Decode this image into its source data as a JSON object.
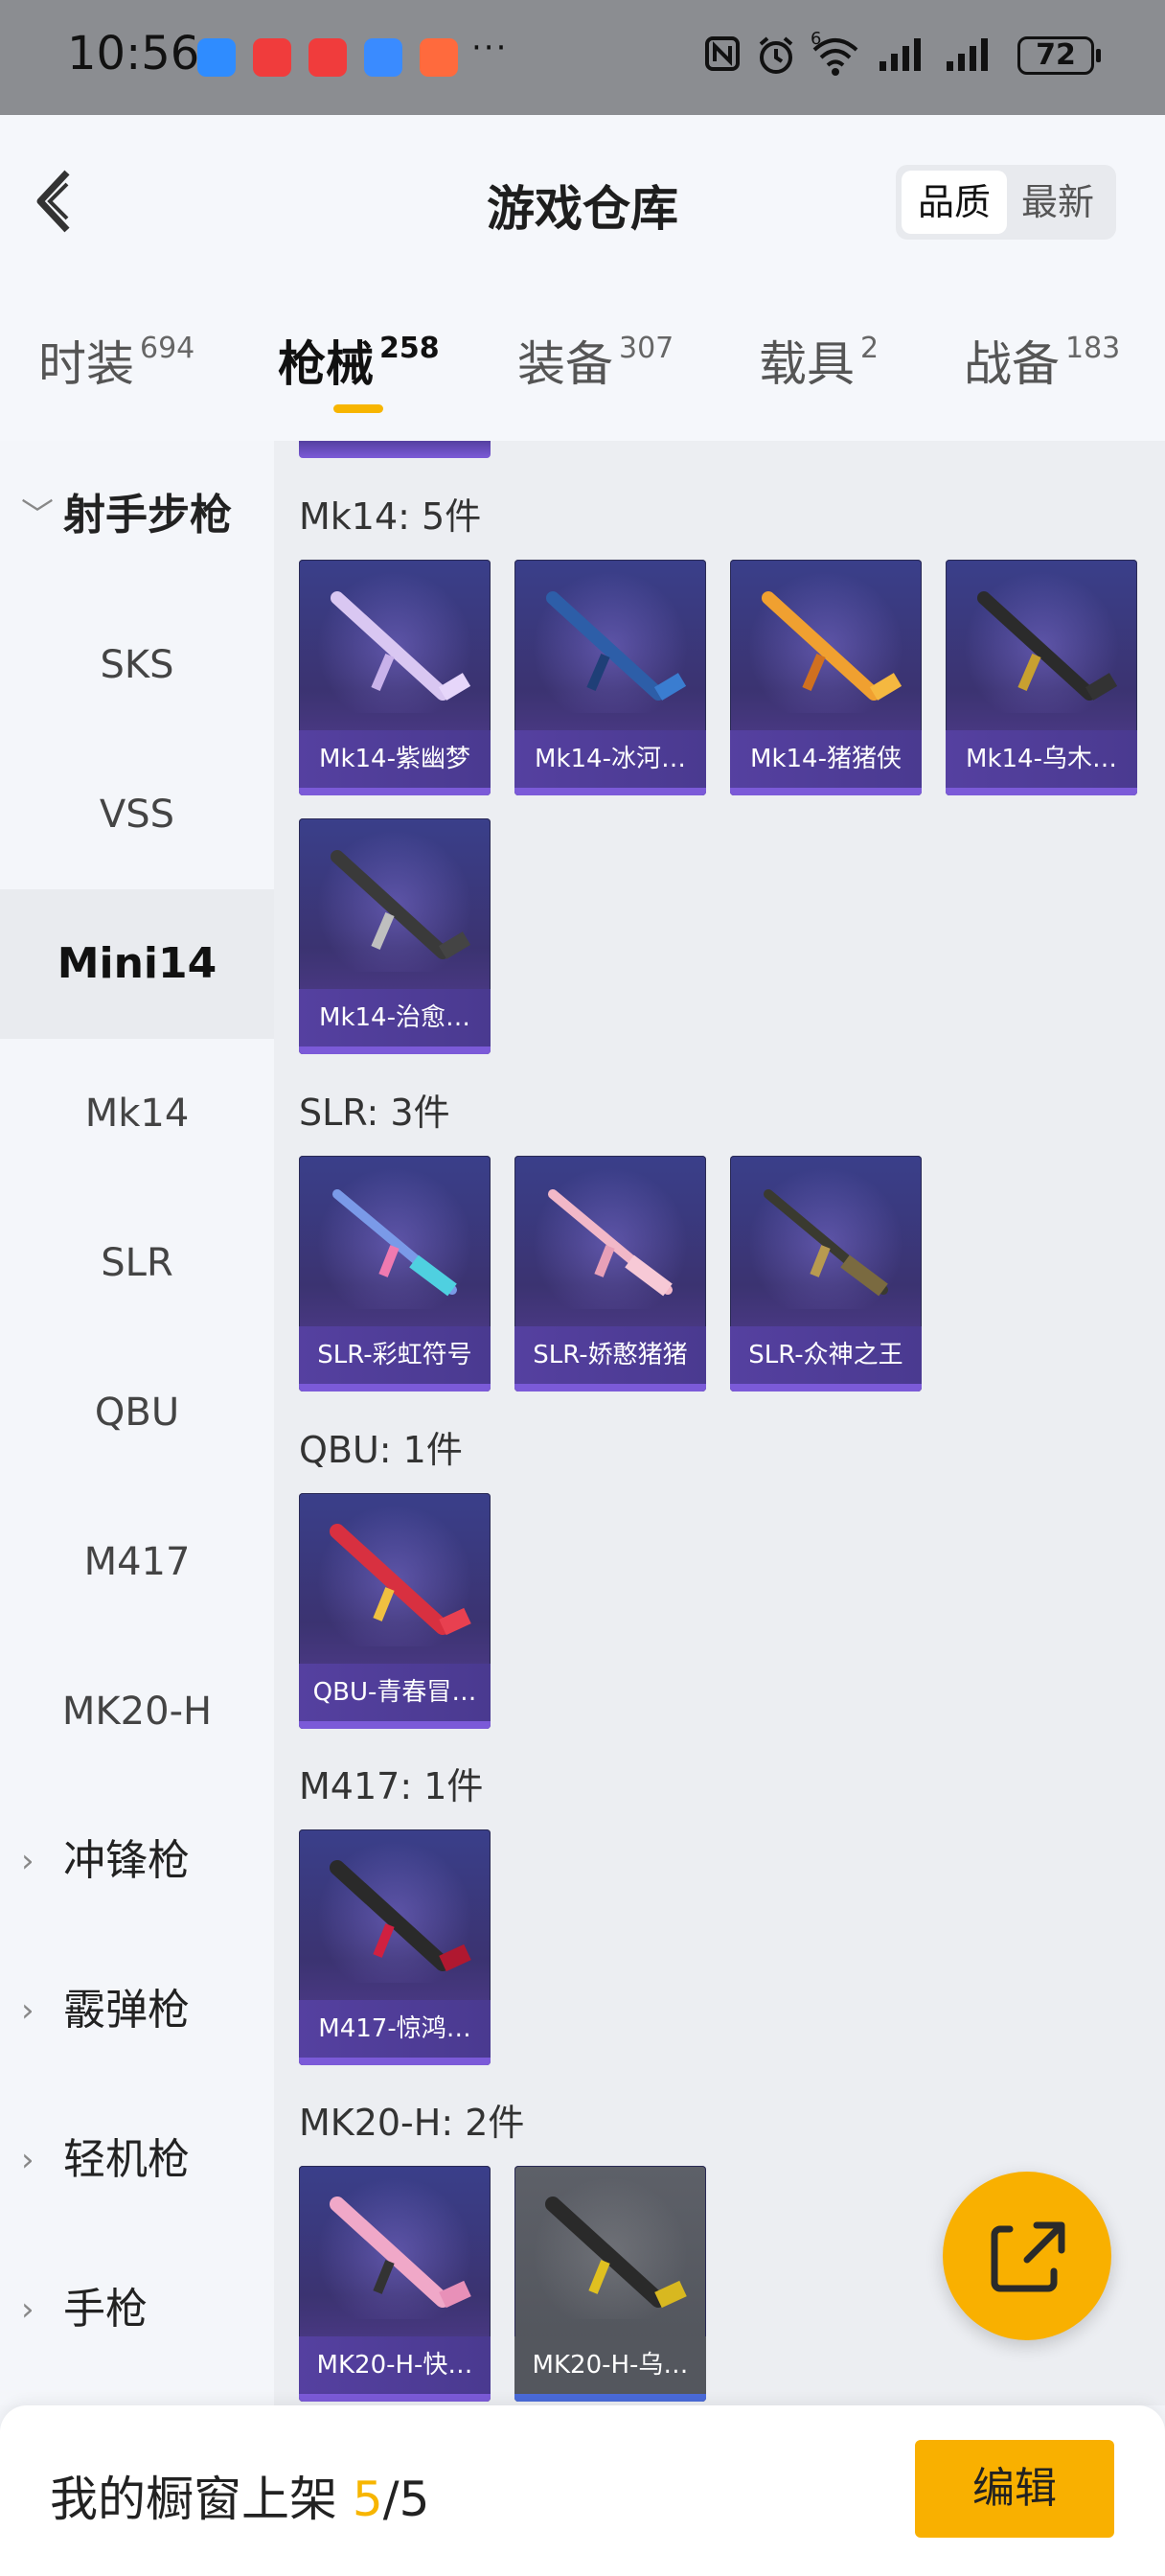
{
  "status_bar": {
    "time": "10:56",
    "app_icons": [
      "#2f8cff",
      "#f03c3c",
      "#f03c3c",
      "#3a8bff",
      "#ff6a3d"
    ],
    "more": "···",
    "signal_label": "6",
    "battery": "72"
  },
  "header": {
    "title": "游戏仓库",
    "sort_options": [
      "品质",
      "最新"
    ],
    "sort_selected": "品质"
  },
  "tabs": [
    {
      "label": "时装",
      "count": "694"
    },
    {
      "label": "枪械",
      "count": "258",
      "active": true
    },
    {
      "label": "装备",
      "count": "307"
    },
    {
      "label": "载具",
      "count": "2"
    },
    {
      "label": "战备",
      "count": "183"
    }
  ],
  "sidebar": {
    "groups": [
      {
        "label": "射手步枪",
        "expanded": true
      },
      {
        "label": "冲锋枪"
      },
      {
        "label": "霰弹枪"
      },
      {
        "label": "轻机枪"
      },
      {
        "label": "手枪"
      }
    ],
    "items": [
      "SKS",
      "VSS",
      "Mini14",
      "Mk14",
      "SLR",
      "QBU",
      "M417",
      "MK20-H"
    ],
    "active_item": "Mini14"
  },
  "content": {
    "groups": [
      {
        "title": "Mk14: 5件",
        "items": [
          "Mk14-紫幽梦",
          "Mk14-冰河…",
          "Mk14-猪猪侠",
          "Mk14-乌木…",
          "Mk14-治愈…"
        ]
      },
      {
        "title": "SLR: 3件",
        "items": [
          "SLR-彩虹符号",
          "SLR-娇憨猪猪",
          "SLR-众神之王"
        ]
      },
      {
        "title": "QBU: 1件",
        "items": [
          "QBU-青春冒…"
        ]
      },
      {
        "title": "M417: 1件",
        "items": [
          "M417-惊鸿…"
        ]
      },
      {
        "title": "MK20-H: 2件",
        "items": [
          "MK20-H-快…",
          "MK20-H-乌…"
        ]
      }
    ]
  },
  "fab": {
    "icon": "share-external-icon"
  },
  "bottom_bar": {
    "label": "我的橱窗上架",
    "count_current": "5",
    "count_sep": "/",
    "count_total": "5",
    "edit_label": "编辑"
  },
  "colors": {
    "accent": "#f9b000",
    "card_purple": "#3b3371",
    "card_grey": "#54575e"
  }
}
